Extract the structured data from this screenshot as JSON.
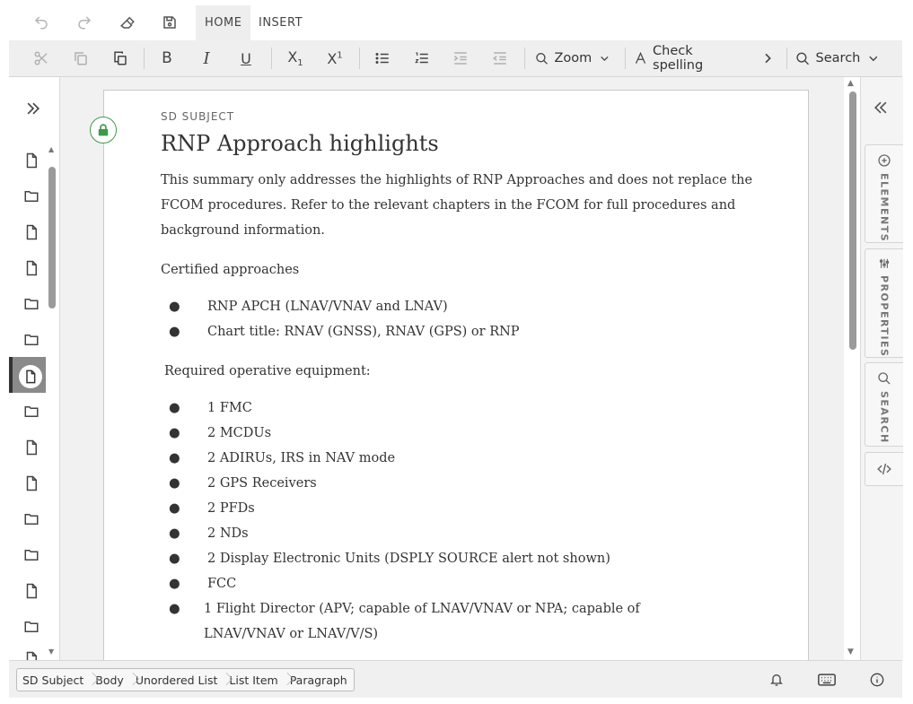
{
  "top_tabs": [
    {
      "label": "HOME",
      "active": true
    },
    {
      "label": "INSERT",
      "active": false
    }
  ],
  "top_icons": [
    "undo-icon",
    "redo-icon",
    "eraser-icon",
    "save-icon"
  ],
  "toolbar": {
    "zoom_label": "Zoom",
    "spell_label": "Check spelling",
    "search_label": "Search"
  },
  "document": {
    "subject_tag": "SD SUBJECT",
    "title": "RNP Approach highlights",
    "intro": "This summary only addresses the highlights of RNP Approaches and does not replace the FCOM procedures. Refer to the relevant chapters in the FCOM for full procedures and background information.",
    "certified_heading": "Certified approaches",
    "certified_items": [
      "RNP APCH (LNAV/VNAV and LNAV)",
      "Chart title: RNAV (GNSS), RNAV (GPS) or RNP"
    ],
    "equipment_heading": "Required operative equipment:",
    "equipment_items": [
      "1 FMC",
      "2 MCDUs",
      "2 ADIRUs, IRS in NAV mode",
      "2 GPS Receivers",
      "2 PFDs",
      "2 NDs",
      "2 Display Electronic Units (DSPLY SOURCE alert not shown)",
      "FCC",
      "1 Flight Director (APV; capable of LNAV/VNAV or NPA; capable of LNAV/VNAV or LNAV/V/S)"
    ]
  },
  "right_panel": {
    "elements_label": "ELEMENTS",
    "properties_label": "PROPERTIES",
    "search_label": "SEARCH"
  },
  "breadcrumbs": [
    "SD Subject",
    "Body",
    "Unordered List",
    "List Item",
    "Paragraph"
  ],
  "colors": {
    "accent_lock": "#3c9a4a",
    "toolbar_bg": "#efefef",
    "canvas_bg": "#f1f1f1"
  }
}
